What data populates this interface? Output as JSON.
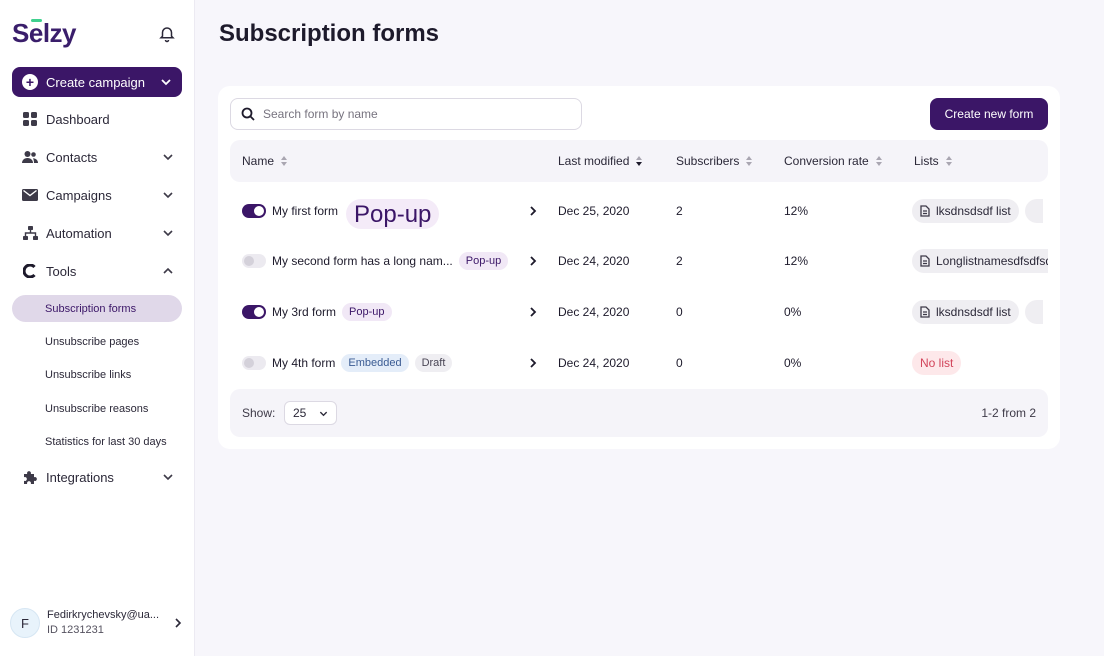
{
  "brand": {
    "logo_first": "S",
    "logo_accent": "e",
    "logo_rest": "lzy"
  },
  "sidebar": {
    "create_label": "Create campaign",
    "items": [
      {
        "label": "Dashboard"
      },
      {
        "label": "Contacts"
      },
      {
        "label": "Campaigns"
      },
      {
        "label": "Automation"
      },
      {
        "label": "Tools"
      },
      {
        "label": "Integrations"
      }
    ],
    "tools_sub": [
      {
        "label": "Subscription forms"
      },
      {
        "label": "Unsubscribe pages"
      },
      {
        "label": "Unsubscribe links"
      },
      {
        "label": "Unsubscribe reasons"
      },
      {
        "label": "Statistics for last 30 days"
      }
    ],
    "user": {
      "initial": "F",
      "email": "Fedirkrychevsky@ua...",
      "id": "ID 1231231"
    }
  },
  "page": {
    "title": "Subscription forms"
  },
  "search": {
    "placeholder": "Search form by name"
  },
  "actions": {
    "create_form": "Create new form"
  },
  "table": {
    "columns": [
      "Name",
      "Last modified",
      "Subscribers",
      "Conversion rate",
      "Lists"
    ],
    "rows": [
      {
        "name": "My first form",
        "badge1": "Pop-up",
        "badge2": "",
        "modified": "Dec 25, 2020",
        "subscribers": "2",
        "conversion": "12%",
        "list": "lksdnsdsdf list",
        "enabled": true
      },
      {
        "name": "My second form has a long nam...",
        "badge1": "Pop-up",
        "badge2": "",
        "modified": "Dec 24, 2020",
        "subscribers": "2",
        "conversion": "12%",
        "list": "Longlistnamesdfsdfsdf",
        "enabled": false
      },
      {
        "name": "My 3rd form",
        "badge1": "Pop-up",
        "badge2": "",
        "modified": "Dec 24, 2020",
        "subscribers": "0",
        "conversion": "0%",
        "list": "lksdnsdsdf list",
        "enabled": true
      },
      {
        "name": "My 4th form",
        "badge1": "Embedded",
        "badge2": "Draft",
        "modified": "Dec 24, 2020",
        "subscribers": "0",
        "conversion": "0%",
        "list": "No list",
        "enabled": false
      }
    ]
  },
  "footer": {
    "show_label": "Show:",
    "page_size": "25",
    "pager": "1-2 from 2"
  },
  "colors": {
    "brand": "#3b1667",
    "accent_green": "#3fd08e",
    "nolist_red": "#d2455b"
  }
}
